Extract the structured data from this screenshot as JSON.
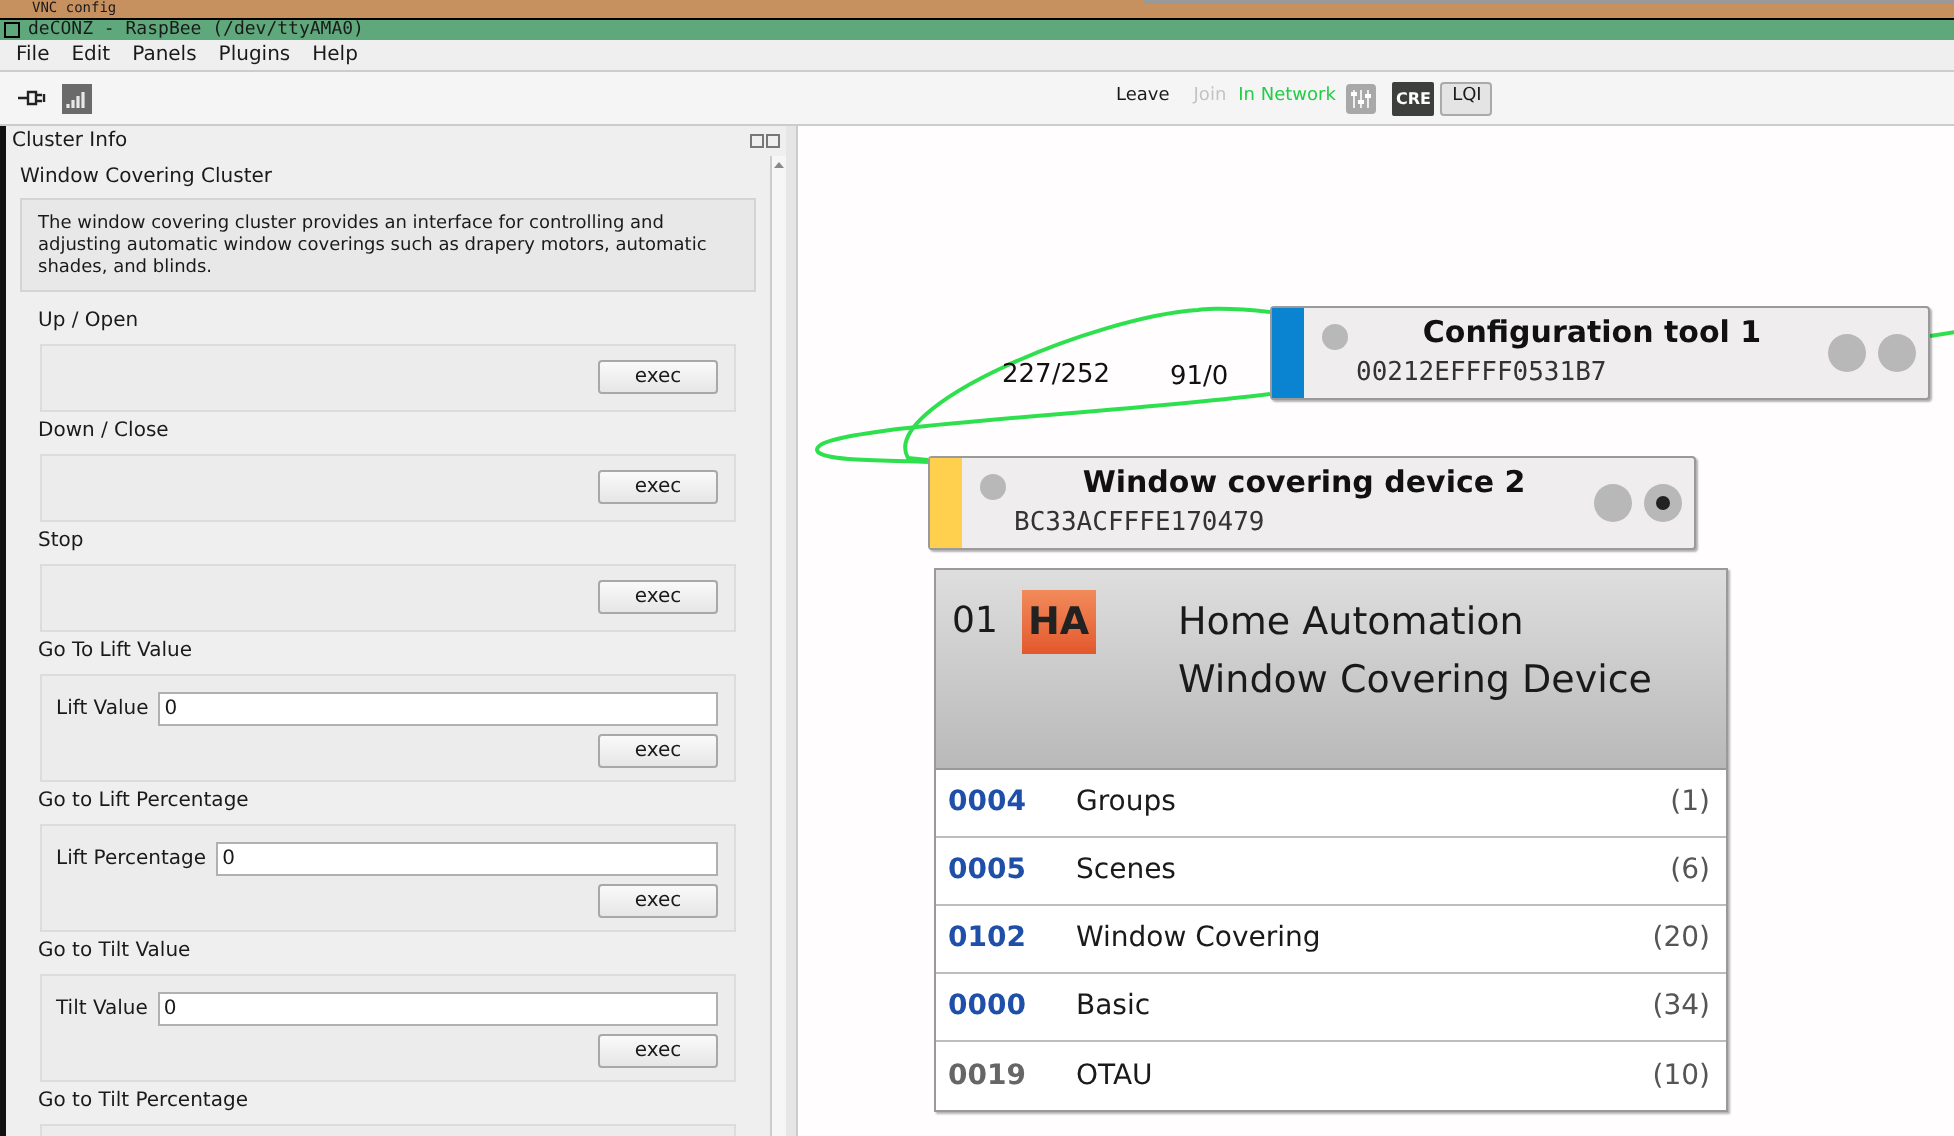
{
  "outer_window": {
    "title": "VNC config"
  },
  "window": {
    "title": "deCONZ - RaspBee (/dev/ttyAMA0)"
  },
  "menu": [
    "File",
    "Edit",
    "Panels",
    "Plugins",
    "Help"
  ],
  "network_bar": {
    "leave": "Leave",
    "join": {
      "label": "Join",
      "disabled": true
    },
    "status": "In Network",
    "cre_label": "CRE",
    "lqi_button": "LQI"
  },
  "cluster_info": {
    "title": "Cluster Info",
    "cluster_name": "Window Covering Cluster",
    "description": "The window covering cluster provides an interface for controlling and adjusting automatic window coverings such as drapery motors, automatic shades, and blinds.",
    "commands": [
      {
        "kind": "button",
        "label": "Up / Open",
        "button": "exec"
      },
      {
        "kind": "button",
        "label": "Down / Close",
        "button": "exec"
      },
      {
        "kind": "button",
        "label": "Stop",
        "button": "exec"
      },
      {
        "kind": "field",
        "label": "Go To Lift Value",
        "field_label": "Lift Value",
        "value": "0",
        "button": "exec"
      },
      {
        "kind": "field",
        "label": "Go to Lift Percentage",
        "field_label": "Lift Percentage",
        "value": "0",
        "button": "exec"
      },
      {
        "kind": "field",
        "label": "Go to Tilt Value",
        "field_label": "Tilt Value",
        "value": "0",
        "button": "exec"
      },
      {
        "kind": "partial",
        "label": "Go to Tilt Percentage"
      }
    ]
  },
  "canvas": {
    "links": [
      {
        "label": "227/252"
      },
      {
        "label": "91/0"
      }
    ],
    "nodes": [
      {
        "name": "Configuration tool 1",
        "address": "00212EFFFF0531B7",
        "color": "#0a84d0",
        "rx_active": false
      },
      {
        "name": "Window covering device 2",
        "address": "BC33ACFFFE170479",
        "color": "#ffd04d",
        "rx_active": true
      }
    ],
    "endpoint": {
      "number": "01",
      "profile_badge": "HA",
      "profile": "Home Automation",
      "device": "Window Covering Device",
      "clusters": [
        {
          "id": "0004",
          "name": "Groups",
          "count": "(1)",
          "kind": "server"
        },
        {
          "id": "0005",
          "name": "Scenes",
          "count": "(6)",
          "kind": "server"
        },
        {
          "id": "0102",
          "name": "Window Covering",
          "count": "(20)",
          "kind": "server"
        },
        {
          "id": "0000",
          "name": "Basic",
          "count": "(34)",
          "kind": "server"
        },
        {
          "id": "0019",
          "name": "OTAU",
          "count": "(10)",
          "kind": "client"
        }
      ]
    }
  }
}
